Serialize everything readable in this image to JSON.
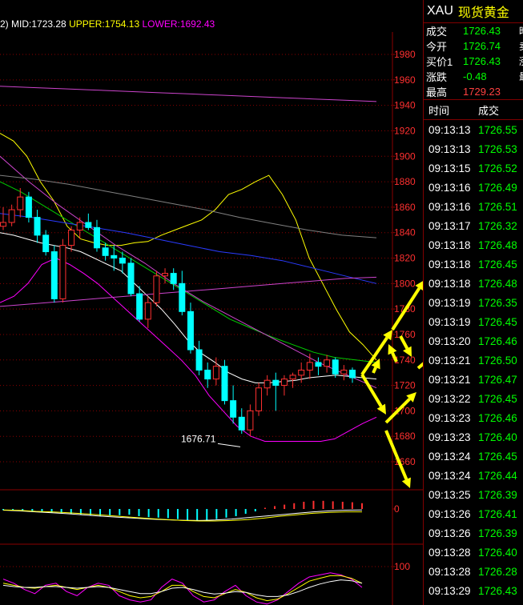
{
  "legend": {
    "prefix": "2)",
    "mid": "MID:1723.28",
    "upper": "UPPER:1754.13",
    "lower": "LOWER:1692.43"
  },
  "colors": {
    "background": "#000000",
    "grid": "#8b0000",
    "bull": "#ff3030",
    "bear": "#00ffff",
    "bb_upper": "#ffff00",
    "bb_lower": "#ff00ff",
    "annotation_arrow": "#ffff00"
  },
  "quote": {
    "symbol": "XAU",
    "name": "现货黄金",
    "rows": [
      {
        "label": "成交",
        "value": "1726.43",
        "dir": "dn"
      },
      {
        "label": "今开",
        "value": "1726.74",
        "dir": "dn"
      },
      {
        "label": "买价1",
        "value": "1726.43",
        "dir": "dn"
      },
      {
        "label": "涨跌",
        "value": "-0.48",
        "dir": "dn"
      },
      {
        "label": "最高",
        "value": "1729.23",
        "dir": "up"
      }
    ],
    "right_cut": [
      "昨",
      "卖",
      "涨",
      "最"
    ]
  },
  "ticks": {
    "time_header": "时间",
    "price_header": "成交",
    "rows": [
      {
        "time": "09:13:13",
        "price": "1726.55"
      },
      {
        "time": "09:13:13",
        "price": "1726.53"
      },
      {
        "time": "09:13:15",
        "price": "1726.52"
      },
      {
        "time": "09:13:16",
        "price": "1726.49"
      },
      {
        "time": "09:13:16",
        "price": "1726.51"
      },
      {
        "time": "09:13:17",
        "price": "1726.32"
      },
      {
        "time": "09:13:18",
        "price": "1726.48"
      },
      {
        "time": "09:13:18",
        "price": "1726.45"
      },
      {
        "time": "09:13:18",
        "price": "1726.48"
      },
      {
        "time": "09:13:19",
        "price": "1726.35"
      },
      {
        "time": "09:13:19",
        "price": "1726.45"
      },
      {
        "time": "09:13:20",
        "price": "1726.46"
      },
      {
        "time": "09:13:21",
        "price": "1726.50"
      },
      {
        "time": "09:13:21",
        "price": "1726.47"
      },
      {
        "time": "09:13:22",
        "price": "1726.45"
      },
      {
        "time": "09:13:23",
        "price": "1726.46"
      },
      {
        "time": "09:13:23",
        "price": "1726.40"
      },
      {
        "time": "09:13:24",
        "price": "1726.45"
      },
      {
        "time": "09:13:24",
        "price": "1726.44"
      },
      {
        "time": "09:13:25",
        "price": "1726.39"
      },
      {
        "time": "09:13:26",
        "price": "1726.41"
      },
      {
        "time": "09:13:26",
        "price": "1726.39"
      },
      {
        "time": "09:13:28",
        "price": "1726.40"
      },
      {
        "time": "09:13:28",
        "price": "1726.28"
      },
      {
        "time": "09:13:29",
        "price": "1726.43"
      }
    ]
  },
  "chart_data": [
    {
      "type": "candlestick",
      "title": "",
      "ylim": [
        1660,
        2000
      ],
      "yticks": [
        1980,
        1960,
        1940,
        1920,
        1900,
        1880,
        1860,
        1840,
        1820,
        1800,
        1780,
        1760,
        1740,
        1720,
        1700,
        1680,
        1660
      ],
      "ytick_labels": [
        "1980",
        "1960",
        "1940",
        "1920",
        "1900",
        "1880",
        "1860",
        "1840",
        "1820",
        "1800",
        "1780",
        "1760",
        "1740",
        "1720",
        "1700",
        "1680",
        "1660"
      ],
      "grid": true,
      "annotations": [
        {
          "text": "1676.71",
          "value": 1676.71
        }
      ],
      "candles": [
        [
          1845,
          1860,
          1842,
          1848
        ],
        [
          1848,
          1862,
          1845,
          1858
        ],
        [
          1858,
          1875,
          1852,
          1868
        ],
        [
          1868,
          1872,
          1848,
          1852
        ],
        [
          1852,
          1858,
          1832,
          1838
        ],
        [
          1838,
          1842,
          1822,
          1825
        ],
        [
          1825,
          1830,
          1785,
          1788
        ],
        [
          1788,
          1835,
          1785,
          1830
        ],
        [
          1830,
          1845,
          1825,
          1842
        ],
        [
          1842,
          1852,
          1835,
          1848
        ],
        [
          1848,
          1855,
          1842,
          1844
        ],
        [
          1844,
          1850,
          1825,
          1828
        ],
        [
          1828,
          1832,
          1818,
          1822
        ],
        [
          1822,
          1830,
          1810,
          1820
        ],
        [
          1820,
          1825,
          1808,
          1816
        ],
        [
          1816,
          1820,
          1790,
          1792
        ],
        [
          1792,
          1798,
          1770,
          1772
        ],
        [
          1772,
          1790,
          1765,
          1785
        ],
        [
          1785,
          1810,
          1782,
          1806
        ],
        [
          1806,
          1812,
          1800,
          1808
        ],
        [
          1808,
          1812,
          1795,
          1800
        ],
        [
          1800,
          1810,
          1775,
          1778
        ],
        [
          1778,
          1785,
          1745,
          1748
        ],
        [
          1748,
          1755,
          1728,
          1732
        ],
        [
          1732,
          1738,
          1718,
          1725
        ],
        [
          1725,
          1742,
          1720,
          1735
        ],
        [
          1735,
          1740,
          1705,
          1708
        ],
        [
          1708,
          1720,
          1690,
          1695
        ],
        [
          1695,
          1702,
          1682,
          1685
        ],
        [
          1685,
          1705,
          1680,
          1700
        ],
        [
          1700,
          1722,
          1696,
          1718
        ],
        [
          1718,
          1728,
          1712,
          1724
        ],
        [
          1724,
          1730,
          1700,
          1720
        ],
        [
          1720,
          1728,
          1712,
          1725
        ],
        [
          1725,
          1730,
          1718,
          1728
        ],
        [
          1728,
          1738,
          1722,
          1732
        ],
        [
          1732,
          1745,
          1725,
          1738
        ],
        [
          1738,
          1742,
          1728,
          1735
        ],
        [
          1735,
          1744,
          1730,
          1740
        ],
        [
          1740,
          1742,
          1726,
          1729
        ],
        [
          1729,
          1736,
          1724,
          1732
        ],
        [
          1732,
          1734,
          1722,
          1726
        ]
      ],
      "lines": [
        {
          "color": "#ffff00",
          "values": [
            1918,
            1912,
            1900,
            1880,
            1865,
            1845,
            1835,
            1832,
            1830,
            1830,
            1832,
            1833,
            1838,
            1842,
            1846,
            1850,
            1858,
            1870,
            1874,
            1880,
            1885,
            1870,
            1850,
            1820,
            1800,
            1780,
            1762,
            1752,
            1740
          ]
        },
        {
          "color": "#ff00ff",
          "values": [
            1785,
            1790,
            1800,
            1815,
            1820,
            1815,
            1808,
            1800,
            1790,
            1780,
            1770,
            1760,
            1750,
            1740,
            1728,
            1712,
            1700,
            1688,
            1680,
            1676,
            1676,
            1676,
            1676,
            1676,
            1678,
            1684,
            1690,
            1695
          ]
        },
        {
          "color": "#ffffff",
          "values": [
            1840,
            1838,
            1835,
            1832,
            1830,
            1828,
            1825,
            1820,
            1815,
            1810,
            1800,
            1790,
            1780,
            1768,
            1755,
            1745,
            1738,
            1730,
            1725,
            1722,
            1722,
            1723,
            1724,
            1726,
            1727,
            1728,
            1727,
            1726,
            1725
          ]
        },
        {
          "color": "#00cc00",
          "values": [
            1880,
            1872,
            1862,
            1852,
            1842,
            1832,
            1822,
            1812,
            1802,
            1792,
            1782,
            1772,
            1765,
            1758,
            1752,
            1746,
            1742,
            1740,
            1738
          ]
        },
        {
          "color": "#2a3bff",
          "values": [
            1855,
            1852,
            1848,
            1844,
            1840,
            1835,
            1830,
            1825,
            1822,
            1818,
            1812,
            1806,
            1800
          ]
        },
        {
          "color": "#cc44cc",
          "values": [
            1900,
            1880,
            1862,
            1846,
            1830,
            1816,
            1800,
            1786,
            1774,
            1762,
            1750,
            1738,
            1728,
            1718
          ]
        },
        {
          "color": "#cc44cc",
          "values": [
            1955,
            1954,
            1953,
            1952,
            1951,
            1950,
            1949,
            1948,
            1947,
            1946,
            1945,
            1944,
            1943
          ]
        },
        {
          "color": "#cc44cc",
          "values": [
            1782,
            1784,
            1786,
            1788,
            1790,
            1792,
            1794,
            1796,
            1798,
            1800,
            1802,
            1804,
            1805
          ]
        },
        {
          "color": "#808080",
          "values": [
            1885,
            1882,
            1878,
            1873,
            1868,
            1863,
            1858,
            1852,
            1847,
            1842,
            1838,
            1836
          ]
        }
      ]
    },
    {
      "type": "bar",
      "title": "",
      "ylim": [
        -1,
        1
      ],
      "yticks": [
        0
      ],
      "ytick_labels": [
        "0"
      ],
      "values": [
        -0.05,
        -0.08,
        -0.1,
        -0.12,
        -0.15,
        -0.16,
        -0.18,
        -0.2,
        -0.24,
        -0.28,
        -0.3,
        -0.28,
        -0.26,
        -0.24,
        -0.3,
        -0.34,
        -0.36,
        -0.38,
        -0.42,
        -0.46,
        -0.5,
        -0.48,
        -0.42,
        -0.36,
        -0.3,
        -0.2,
        -0.1,
        0.05,
        0.12,
        0.18,
        0.24,
        0.3,
        0.34,
        0.34,
        0.32,
        0.3,
        0.28,
        0.24
      ],
      "series": [
        {
          "color": "#ffffff",
          "values": [
            -0.05,
            -0.08,
            -0.12,
            -0.16,
            -0.2,
            -0.25,
            -0.3,
            -0.34,
            -0.38,
            -0.42,
            -0.45,
            -0.47,
            -0.48,
            -0.46,
            -0.42,
            -0.36,
            -0.3,
            -0.24,
            -0.18,
            -0.12,
            -0.08,
            -0.05,
            -0.04
          ]
        },
        {
          "color": "#ffff00",
          "values": [
            -0.04,
            -0.06,
            -0.1,
            -0.12,
            -0.16,
            -0.2,
            -0.25,
            -0.3,
            -0.35,
            -0.4,
            -0.44,
            -0.48,
            -0.5,
            -0.5,
            -0.48,
            -0.44,
            -0.38,
            -0.3,
            -0.24,
            -0.18,
            -0.14,
            -0.12,
            -0.12
          ]
        }
      ]
    },
    {
      "type": "line",
      "title": "",
      "ylim": [
        0,
        120
      ],
      "yticks": [
        100
      ],
      "ytick_labels": [
        "100"
      ],
      "series": [
        {
          "color": "#ff00ff",
          "values": [
            70,
            60,
            45,
            35,
            55,
            60,
            40,
            30,
            50,
            60,
            55,
            30,
            20,
            15,
            20,
            50,
            70,
            60,
            30,
            15,
            20,
            40,
            55,
            30,
            15,
            10,
            20,
            40,
            60,
            75,
            80,
            85,
            80,
            70,
            50
          ]
        },
        {
          "color": "#ffff00",
          "values": [
            60,
            55,
            50,
            48,
            52,
            55,
            50,
            45,
            50,
            55,
            50,
            40,
            30,
            25,
            28,
            40,
            55,
            55,
            40,
            28,
            25,
            35,
            45,
            38,
            25,
            18,
            22,
            35,
            50,
            65,
            72,
            78,
            78,
            72,
            60
          ]
        },
        {
          "color": "#ffffff",
          "values": [
            55,
            52,
            50,
            50,
            52,
            52,
            50,
            48,
            50,
            52,
            50,
            45,
            40,
            35,
            35,
            40,
            48,
            50,
            45,
            38,
            34,
            36,
            40,
            38,
            32,
            28,
            28,
            32,
            40,
            50,
            58,
            64,
            68,
            66,
            60
          ]
        }
      ]
    }
  ]
}
